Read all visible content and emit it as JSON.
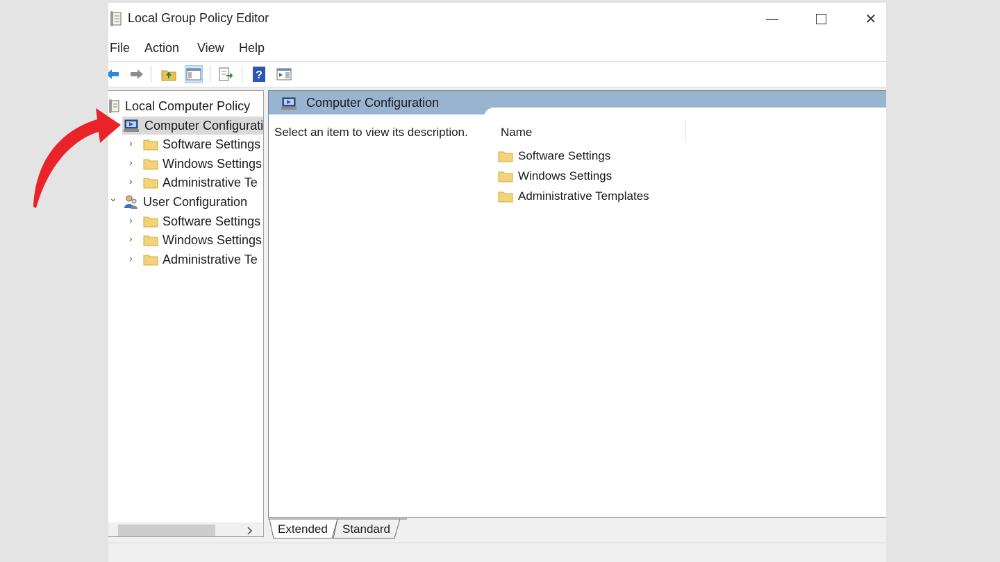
{
  "window": {
    "title": "Local Group Policy Editor",
    "minimize_glyph": "—",
    "close_glyph": "✕"
  },
  "menu": [
    "File",
    "Action",
    "View",
    "Help"
  ],
  "tree": {
    "root": "Local Computer Policy",
    "computer_config": "Computer Configurati",
    "cc_children": [
      "Software Settings",
      "Windows Settings",
      "Administrative Te"
    ],
    "user_config": "User Configuration",
    "uc_children": [
      "Software Settings",
      "Windows Settings",
      "Administrative Te"
    ],
    "collapsed_chevron": "›",
    "expanded_chevron": "⌄"
  },
  "right_pane": {
    "title": "Computer Configuration",
    "description": "Select an item to view its description.",
    "column_name": "Name",
    "items": [
      "Software Settings",
      "Windows Settings",
      "Administrative Templates"
    ]
  },
  "tabs": [
    "Extended",
    "Standard"
  ],
  "colors": {
    "header_band": "#99b4d1",
    "selection": "#d9d9d9",
    "folder": "#f3d379",
    "annotation_arrow": "#e8232a"
  }
}
